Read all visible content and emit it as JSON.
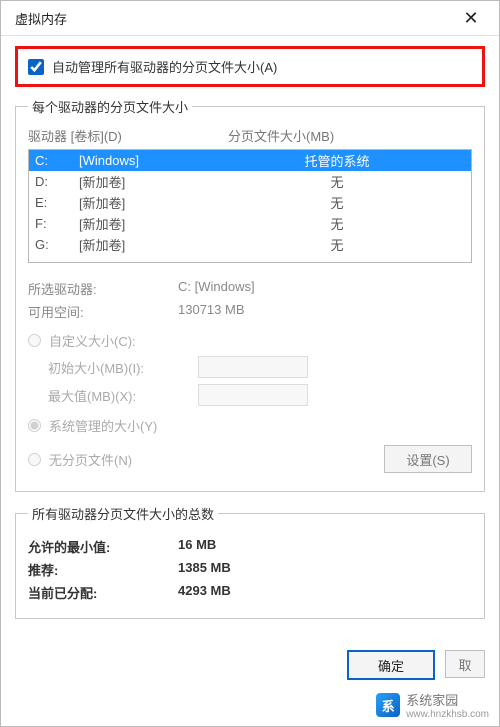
{
  "window": {
    "title": "虚拟内存",
    "close": "✕"
  },
  "auto": {
    "checked": true,
    "label": "自动管理所有驱动器的分页文件大小(A)"
  },
  "group1": {
    "legend": "每个驱动器的分页文件大小",
    "header_drive": "驱动器 [卷标](D)",
    "header_size": "分页文件大小(MB)",
    "drives": [
      {
        "letter": "C:",
        "label": "[Windows]",
        "page": "托管的系统",
        "selected": true
      },
      {
        "letter": "D:",
        "label": "[新加卷]",
        "page": "无",
        "selected": false
      },
      {
        "letter": "E:",
        "label": "[新加卷]",
        "page": "无",
        "selected": false
      },
      {
        "letter": "F:",
        "label": "[新加卷]",
        "page": "无",
        "selected": false
      },
      {
        "letter": "G:",
        "label": "[新加卷]",
        "page": "无",
        "selected": false
      }
    ],
    "selected_drive_label": "所选驱动器:",
    "selected_drive_value": "C: [Windows]",
    "free_space_label": "可用空间:",
    "free_space_value": "130713 MB",
    "custom_radio": "自定义大小(C):",
    "initial_label": "初始大小(MB)(I):",
    "initial_value": "",
    "max_label": "最大值(MB)(X):",
    "max_value": "",
    "system_radio": "系统管理的大小(Y)",
    "none_radio": "无分页文件(N)",
    "set_btn": "设置(S)"
  },
  "group2": {
    "legend": "所有驱动器分页文件大小的总数",
    "min_label": "允许的最小值:",
    "min_value": "16 MB",
    "rec_label": "推荐:",
    "rec_value": "1385 MB",
    "cur_label": "当前已分配:",
    "cur_value": "4293 MB"
  },
  "footer": {
    "ok": "确定",
    "cancel": "取"
  },
  "watermark": {
    "icon": "系",
    "text": "系统家园",
    "url": "www.hnzkhsb.com"
  }
}
